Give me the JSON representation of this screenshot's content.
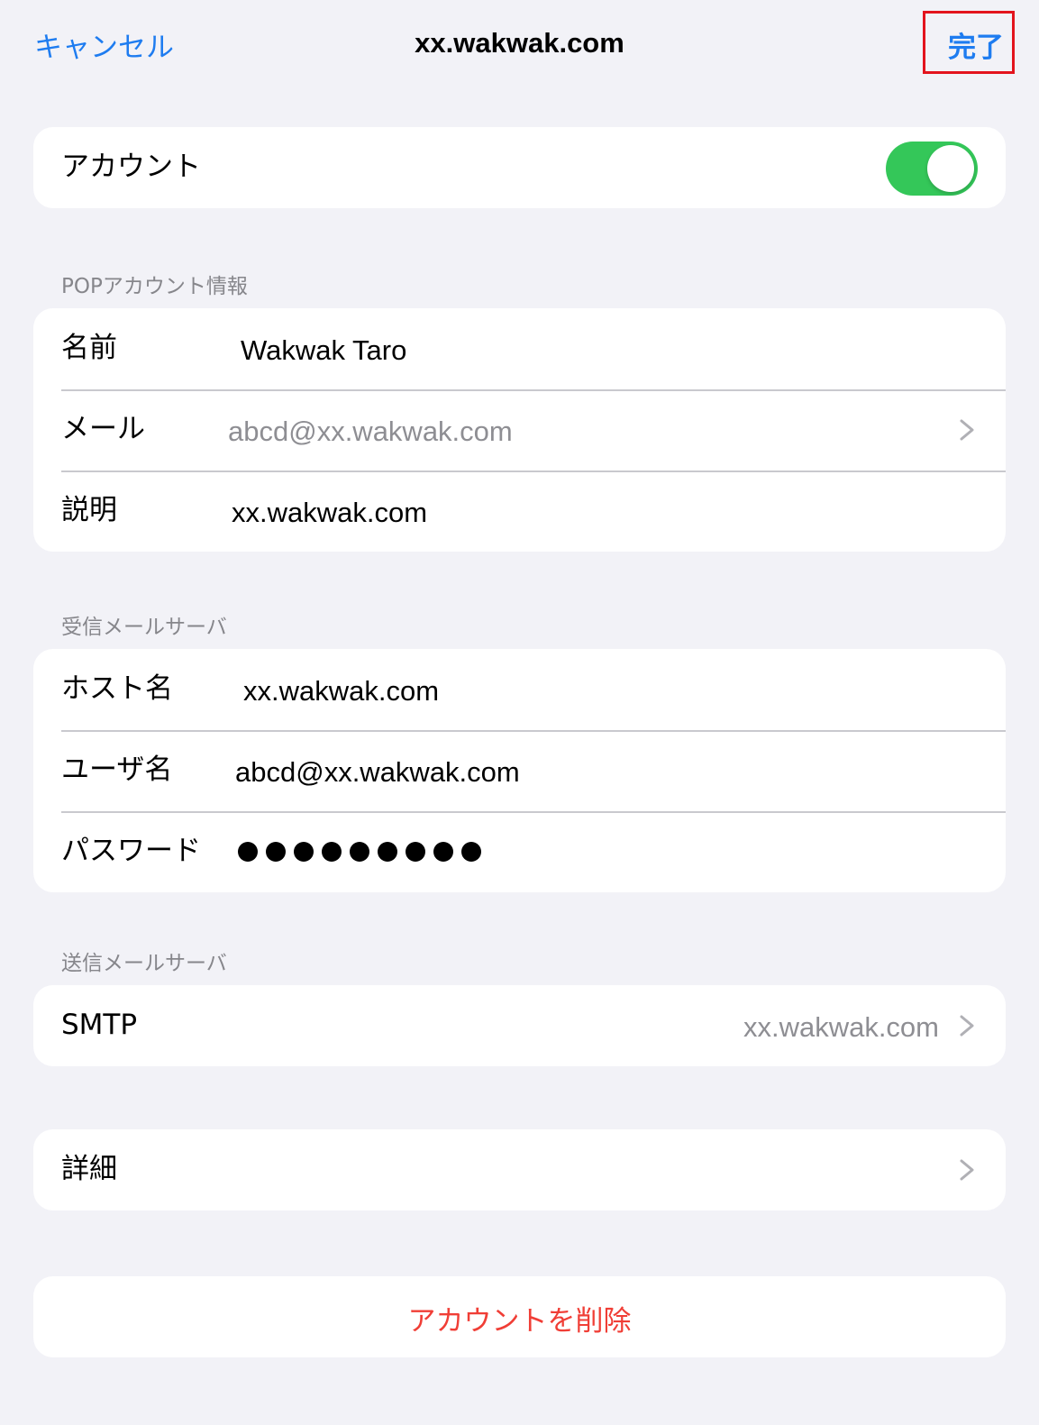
{
  "nav": {
    "cancel_label": "キャンセル",
    "title": "xx.wakwak.com",
    "done_label": "完了"
  },
  "account_toggle": {
    "label": "アカウント",
    "on": true
  },
  "pop_section": {
    "header": "POPアカウント情報",
    "rows": [
      {
        "label": "名前",
        "value": "Wakwak Taro"
      },
      {
        "label": "メール",
        "value": "abcd@xx.wakwak.com"
      },
      {
        "label": "説明",
        "value": "xx.wakwak.com"
      }
    ]
  },
  "incoming_section": {
    "header": "受信メールサーバ",
    "rows": [
      {
        "label": "ホスト名",
        "value": "xx.wakwak.com"
      },
      {
        "label": "ユーザ名",
        "value": "abcd@xx.wakwak.com"
      },
      {
        "label": "パスワード",
        "dot_count": 9
      }
    ]
  },
  "outgoing_section": {
    "header": "送信メールサーバ",
    "rows": [
      {
        "label": "SMTP",
        "value": "xx.wakwak.com"
      }
    ]
  },
  "advanced": {
    "label": "詳細"
  },
  "delete_account": {
    "label": "アカウントを削除"
  },
  "colors": {
    "accent": "#1e7cf0",
    "toggle_on": "#34c759",
    "destructive": "#f03e36",
    "highlight_box": "#e3141d"
  },
  "icons": {
    "chevron": "chevron-right-icon"
  }
}
